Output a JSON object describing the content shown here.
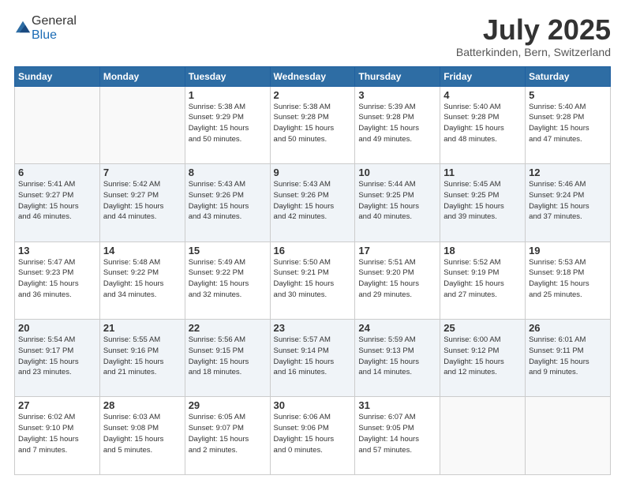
{
  "header": {
    "logo_general": "General",
    "logo_blue": "Blue",
    "month_title": "July 2025",
    "location": "Batterkinden, Bern, Switzerland"
  },
  "weekdays": [
    "Sunday",
    "Monday",
    "Tuesday",
    "Wednesday",
    "Thursday",
    "Friday",
    "Saturday"
  ],
  "weeks": [
    [
      {
        "day": "",
        "info": ""
      },
      {
        "day": "",
        "info": ""
      },
      {
        "day": "1",
        "info": "Sunrise: 5:38 AM\nSunset: 9:29 PM\nDaylight: 15 hours\nand 50 minutes."
      },
      {
        "day": "2",
        "info": "Sunrise: 5:38 AM\nSunset: 9:28 PM\nDaylight: 15 hours\nand 50 minutes."
      },
      {
        "day": "3",
        "info": "Sunrise: 5:39 AM\nSunset: 9:28 PM\nDaylight: 15 hours\nand 49 minutes."
      },
      {
        "day": "4",
        "info": "Sunrise: 5:40 AM\nSunset: 9:28 PM\nDaylight: 15 hours\nand 48 minutes."
      },
      {
        "day": "5",
        "info": "Sunrise: 5:40 AM\nSunset: 9:28 PM\nDaylight: 15 hours\nand 47 minutes."
      }
    ],
    [
      {
        "day": "6",
        "info": "Sunrise: 5:41 AM\nSunset: 9:27 PM\nDaylight: 15 hours\nand 46 minutes."
      },
      {
        "day": "7",
        "info": "Sunrise: 5:42 AM\nSunset: 9:27 PM\nDaylight: 15 hours\nand 44 minutes."
      },
      {
        "day": "8",
        "info": "Sunrise: 5:43 AM\nSunset: 9:26 PM\nDaylight: 15 hours\nand 43 minutes."
      },
      {
        "day": "9",
        "info": "Sunrise: 5:43 AM\nSunset: 9:26 PM\nDaylight: 15 hours\nand 42 minutes."
      },
      {
        "day": "10",
        "info": "Sunrise: 5:44 AM\nSunset: 9:25 PM\nDaylight: 15 hours\nand 40 minutes."
      },
      {
        "day": "11",
        "info": "Sunrise: 5:45 AM\nSunset: 9:25 PM\nDaylight: 15 hours\nand 39 minutes."
      },
      {
        "day": "12",
        "info": "Sunrise: 5:46 AM\nSunset: 9:24 PM\nDaylight: 15 hours\nand 37 minutes."
      }
    ],
    [
      {
        "day": "13",
        "info": "Sunrise: 5:47 AM\nSunset: 9:23 PM\nDaylight: 15 hours\nand 36 minutes."
      },
      {
        "day": "14",
        "info": "Sunrise: 5:48 AM\nSunset: 9:22 PM\nDaylight: 15 hours\nand 34 minutes."
      },
      {
        "day": "15",
        "info": "Sunrise: 5:49 AM\nSunset: 9:22 PM\nDaylight: 15 hours\nand 32 minutes."
      },
      {
        "day": "16",
        "info": "Sunrise: 5:50 AM\nSunset: 9:21 PM\nDaylight: 15 hours\nand 30 minutes."
      },
      {
        "day": "17",
        "info": "Sunrise: 5:51 AM\nSunset: 9:20 PM\nDaylight: 15 hours\nand 29 minutes."
      },
      {
        "day": "18",
        "info": "Sunrise: 5:52 AM\nSunset: 9:19 PM\nDaylight: 15 hours\nand 27 minutes."
      },
      {
        "day": "19",
        "info": "Sunrise: 5:53 AM\nSunset: 9:18 PM\nDaylight: 15 hours\nand 25 minutes."
      }
    ],
    [
      {
        "day": "20",
        "info": "Sunrise: 5:54 AM\nSunset: 9:17 PM\nDaylight: 15 hours\nand 23 minutes."
      },
      {
        "day": "21",
        "info": "Sunrise: 5:55 AM\nSunset: 9:16 PM\nDaylight: 15 hours\nand 21 minutes."
      },
      {
        "day": "22",
        "info": "Sunrise: 5:56 AM\nSunset: 9:15 PM\nDaylight: 15 hours\nand 18 minutes."
      },
      {
        "day": "23",
        "info": "Sunrise: 5:57 AM\nSunset: 9:14 PM\nDaylight: 15 hours\nand 16 minutes."
      },
      {
        "day": "24",
        "info": "Sunrise: 5:59 AM\nSunset: 9:13 PM\nDaylight: 15 hours\nand 14 minutes."
      },
      {
        "day": "25",
        "info": "Sunrise: 6:00 AM\nSunset: 9:12 PM\nDaylight: 15 hours\nand 12 minutes."
      },
      {
        "day": "26",
        "info": "Sunrise: 6:01 AM\nSunset: 9:11 PM\nDaylight: 15 hours\nand 9 minutes."
      }
    ],
    [
      {
        "day": "27",
        "info": "Sunrise: 6:02 AM\nSunset: 9:10 PM\nDaylight: 15 hours\nand 7 minutes."
      },
      {
        "day": "28",
        "info": "Sunrise: 6:03 AM\nSunset: 9:08 PM\nDaylight: 15 hours\nand 5 minutes."
      },
      {
        "day": "29",
        "info": "Sunrise: 6:05 AM\nSunset: 9:07 PM\nDaylight: 15 hours\nand 2 minutes."
      },
      {
        "day": "30",
        "info": "Sunrise: 6:06 AM\nSunset: 9:06 PM\nDaylight: 15 hours\nand 0 minutes."
      },
      {
        "day": "31",
        "info": "Sunrise: 6:07 AM\nSunset: 9:05 PM\nDaylight: 14 hours\nand 57 minutes."
      },
      {
        "day": "",
        "info": ""
      },
      {
        "day": "",
        "info": ""
      }
    ]
  ]
}
